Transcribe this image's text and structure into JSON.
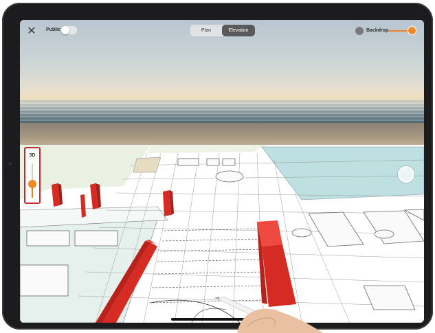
{
  "topbar": {
    "close_icon": "close-icon",
    "public_label": "Public",
    "public_toggle_on": false,
    "view_tabs": [
      {
        "label": "Plan",
        "active": false
      },
      {
        "label": "Elevation",
        "active": true
      }
    ],
    "backdrop_label": "Backdrop",
    "backdrop_level": 1.0
  },
  "depth_slider": {
    "label": "3D",
    "level": 0.4
  },
  "scene": {
    "backdrop": "beach-photo",
    "model": "architectural-plan-3d"
  },
  "colors": {
    "accent": "#f0882a",
    "wall_red": "#d62b22",
    "highlight_border": "#c8282c",
    "pool": "#bfe0e0"
  }
}
